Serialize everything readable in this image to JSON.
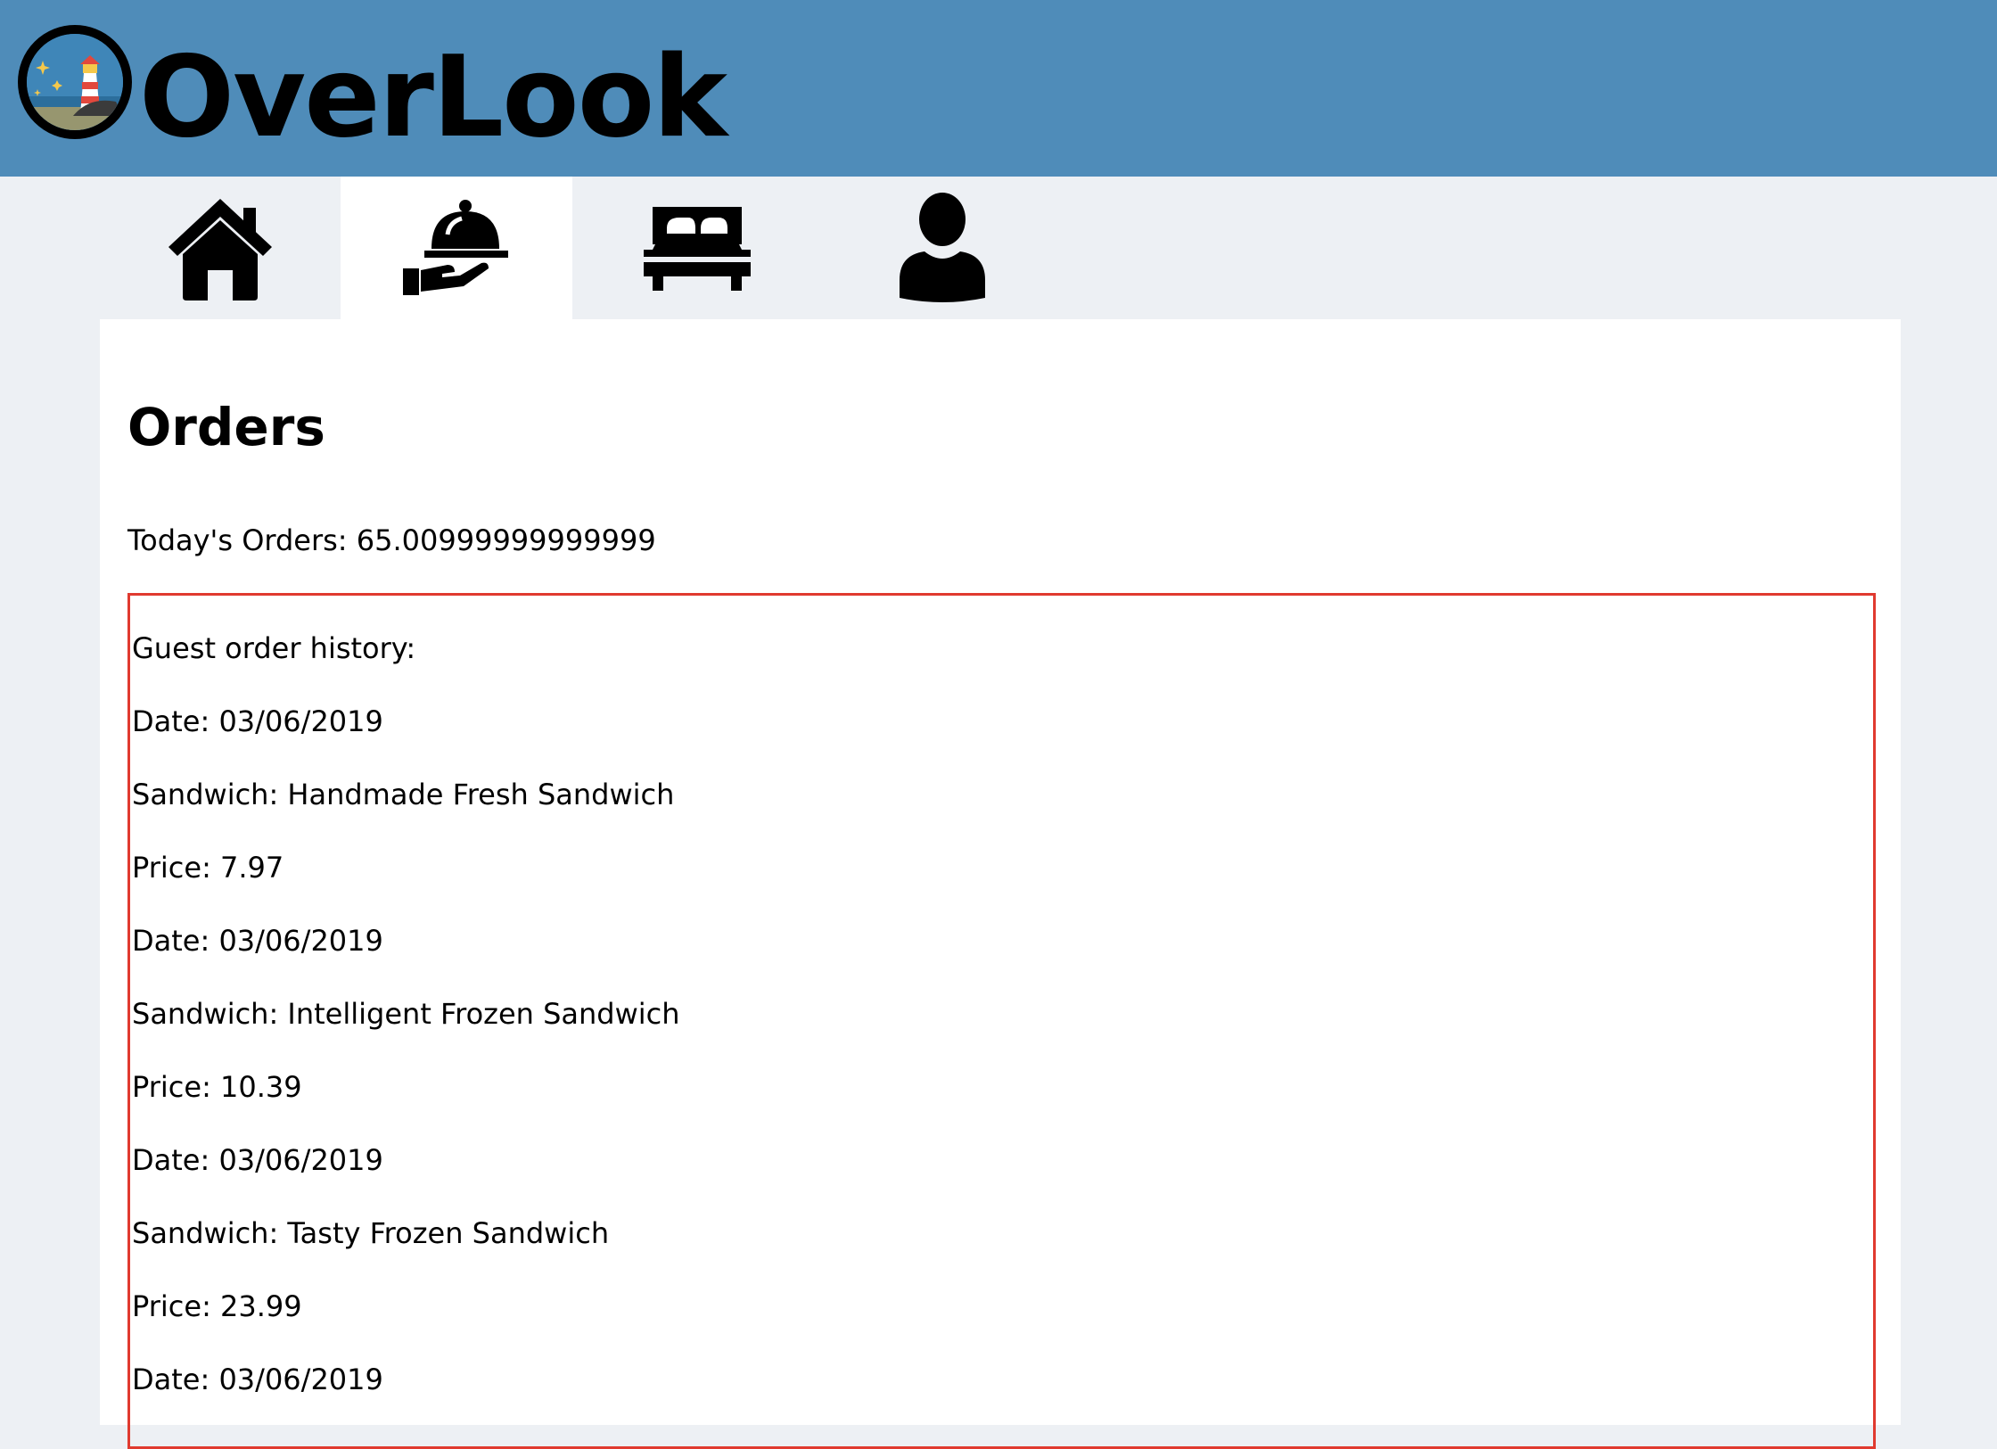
{
  "app": {
    "brand": "OverLook"
  },
  "nav": {
    "tabs": [
      {
        "icon": "home-icon",
        "label": "Home"
      },
      {
        "icon": "room-service-icon",
        "label": "Orders"
      },
      {
        "icon": "bed-icon",
        "label": "Rooms"
      },
      {
        "icon": "user-icon",
        "label": "Guests"
      }
    ]
  },
  "orders": {
    "title": "Orders",
    "today_summary": "Today's Orders: 65.00999999999999",
    "history": {
      "heading": "Guest order history:",
      "lines": [
        "Date: 03/06/2019",
        "Sandwich: Handmade Fresh Sandwich",
        "Price: 7.97",
        "Date: 03/06/2019",
        "Sandwich: Intelligent Frozen Sandwich",
        "Price: 10.39",
        "Date: 03/06/2019",
        "Sandwich: Tasty Frozen Sandwich",
        "Price: 23.99",
        "Date: 03/06/2019"
      ]
    }
  },
  "colors": {
    "header_bg": "#4f8cb9",
    "page_bg": "#edf0f4",
    "history_border": "#e03a2f"
  }
}
